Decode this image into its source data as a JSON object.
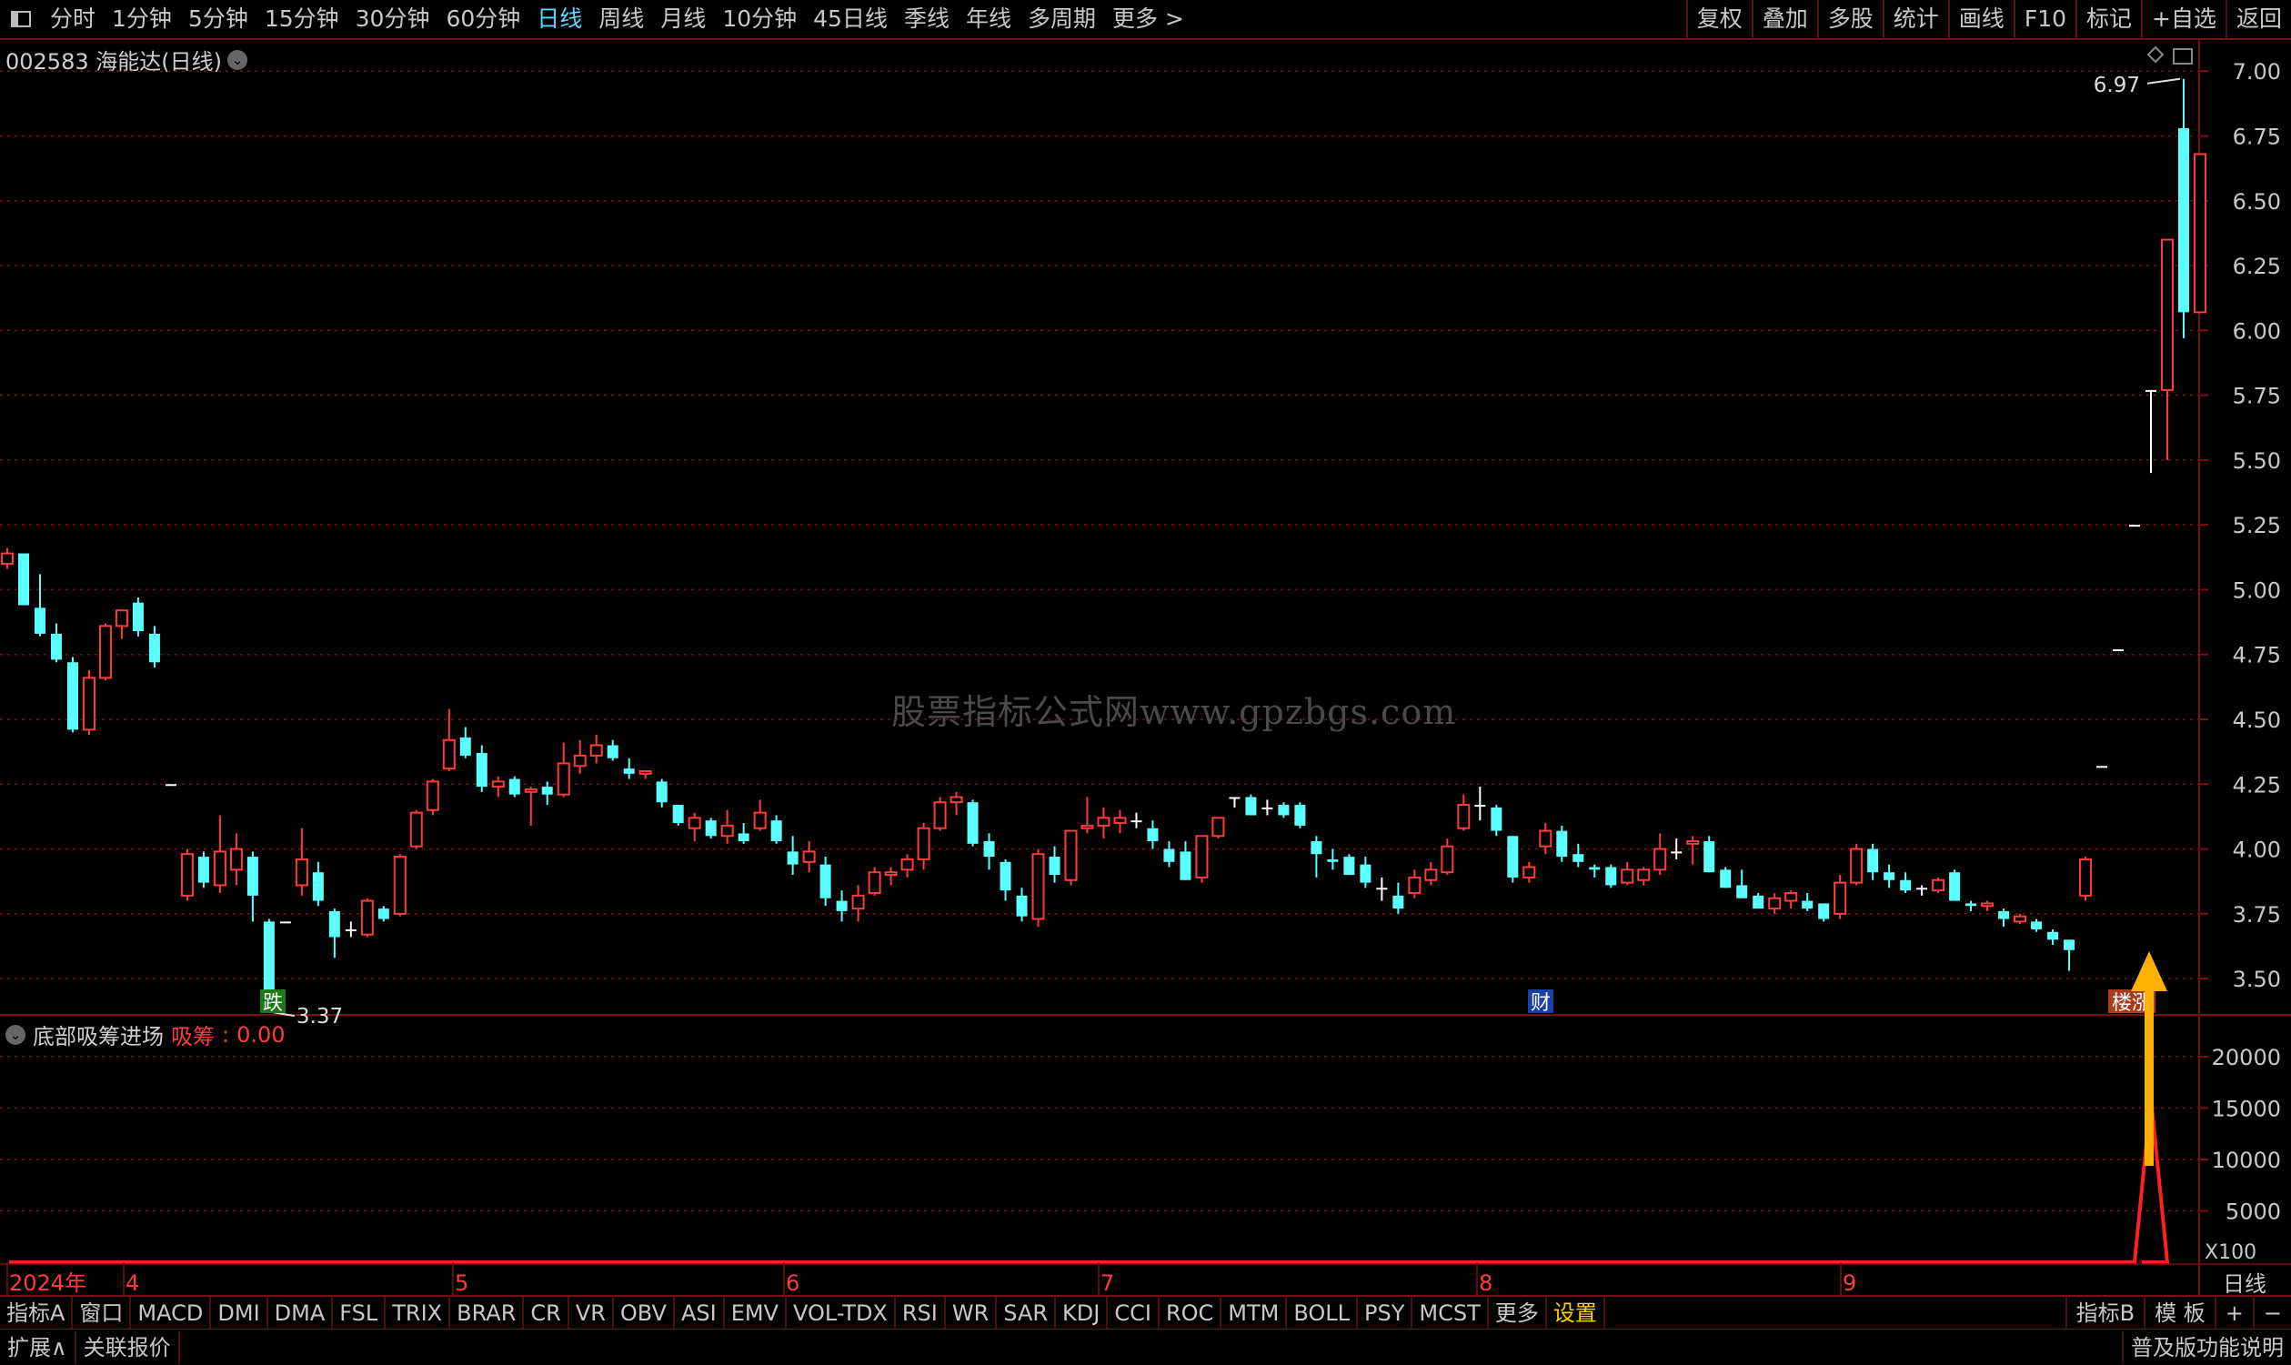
{
  "toolbar": {
    "periods": [
      "分时",
      "1分钟",
      "5分钟",
      "15分钟",
      "30分钟",
      "60分钟",
      "日线",
      "周线",
      "月线",
      "10分钟",
      "45日线",
      "季线",
      "年线",
      "多周期",
      "更多 >"
    ],
    "active_period": "日线",
    "right_buttons": [
      "复权",
      "叠加",
      "多股",
      "统计",
      "画线",
      "F10",
      "标记",
      "+自选",
      "返回"
    ]
  },
  "stock_title": "002583 海能达(日线)",
  "indicator": {
    "name": "底部吸筹进场",
    "label": "吸筹",
    "value": "0.00"
  },
  "watermark": "股票指标公式网www.gpzbgs.com",
  "bottom_tabs": [
    "指标A",
    "窗口",
    "MACD",
    "DMI",
    "DMA",
    "FSL",
    "TRIX",
    "BRAR",
    "CR",
    "VR",
    "OBV",
    "ASI",
    "EMV",
    "VOL-TDX",
    "RSI",
    "WR",
    "SAR",
    "KDJ",
    "CCI",
    "ROC",
    "MTM",
    "BOLL",
    "PSY",
    "MCST",
    "更多",
    "设置"
  ],
  "bottom_right": [
    "指标B",
    "模 板",
    "+",
    "−"
  ],
  "status": {
    "expand": "扩展∧",
    "related": "关联报价",
    "right": "普及版功能说明",
    "period_label": "日线"
  },
  "colors": {
    "up": "#ff3b3b",
    "down": "#5affff",
    "grid": "#7a1010",
    "signal": "#ffb000"
  },
  "chart_data": {
    "type": "candlestick",
    "price_axis": {
      "ylim": [
        3.36,
        7.12
      ],
      "ticks": [
        "7.00",
        "6.75",
        "6.50",
        "6.25",
        "6.00",
        "5.75",
        "5.50",
        "5.25",
        "5.00",
        "4.75",
        "4.50",
        "4.25",
        "4.00",
        "3.75",
        "3.50"
      ]
    },
    "month_labels": [
      "2024年",
      "4",
      "5",
      "6",
      "7",
      "8",
      "9"
    ],
    "high_label": "6.97",
    "low_label": "3.37",
    "markers": [
      "跌",
      "财",
      "楼涨"
    ],
    "candles": [
      [
        5.1,
        5.16,
        5.08,
        5.14
      ],
      [
        5.14,
        5.1,
        5.05,
        4.94
      ],
      [
        4.93,
        5.06,
        4.82,
        4.83
      ],
      [
        4.83,
        4.87,
        4.72,
        4.73
      ],
      [
        4.72,
        4.74,
        4.45,
        4.46
      ],
      [
        4.46,
        4.69,
        4.44,
        4.66
      ],
      [
        4.66,
        4.87,
        4.65,
        4.86
      ],
      [
        4.86,
        4.92,
        4.81,
        4.92
      ],
      [
        4.95,
        4.97,
        4.82,
        4.84
      ],
      [
        4.83,
        4.86,
        4.7,
        4.72
      ],
      [
        4.25,
        4.25,
        4.25,
        4.25
      ],
      [
        3.82,
        4.0,
        3.8,
        3.98
      ],
      [
        3.97,
        3.99,
        3.85,
        3.87
      ],
      [
        3.86,
        4.13,
        3.83,
        3.99
      ],
      [
        3.92,
        4.06,
        3.86,
        4.0
      ],
      [
        3.97,
        3.99,
        3.72,
        3.82
      ],
      [
        3.72,
        3.73,
        3.37,
        3.4
      ],
      [
        3.72,
        3.72,
        3.72,
        3.72
      ],
      [
        3.86,
        4.08,
        3.82,
        3.96
      ],
      [
        3.91,
        3.95,
        3.78,
        3.8
      ],
      [
        3.76,
        3.77,
        3.58,
        3.66
      ],
      [
        3.69,
        3.72,
        3.66,
        3.69
      ],
      [
        3.67,
        3.81,
        3.66,
        3.8
      ],
      [
        3.77,
        3.78,
        3.72,
        3.73
      ],
      [
        3.75,
        3.98,
        3.74,
        3.97
      ],
      [
        4.01,
        4.15,
        4.0,
        4.14
      ],
      [
        4.15,
        4.27,
        4.13,
        4.26
      ],
      [
        4.31,
        4.54,
        4.3,
        4.42
      ],
      [
        4.43,
        4.47,
        4.35,
        4.36
      ],
      [
        4.37,
        4.4,
        4.22,
        4.24
      ],
      [
        4.24,
        4.28,
        4.2,
        4.26
      ],
      [
        4.27,
        4.28,
        4.2,
        4.21
      ],
      [
        4.22,
        4.24,
        4.09,
        4.23
      ],
      [
        4.24,
        4.26,
        4.17,
        4.21
      ],
      [
        4.21,
        4.41,
        4.2,
        4.33
      ],
      [
        4.32,
        4.42,
        4.29,
        4.36
      ],
      [
        4.36,
        4.44,
        4.33,
        4.4
      ],
      [
        4.4,
        4.42,
        4.34,
        4.35
      ],
      [
        4.31,
        4.35,
        4.27,
        4.29
      ],
      [
        4.29,
        4.3,
        4.27,
        4.3
      ],
      [
        4.26,
        4.27,
        4.16,
        4.18
      ],
      [
        4.17,
        4.17,
        4.09,
        4.1
      ],
      [
        4.08,
        4.14,
        4.03,
        4.12
      ],
      [
        4.11,
        4.12,
        4.04,
        4.05
      ],
      [
        4.05,
        4.15,
        4.02,
        4.09
      ],
      [
        4.06,
        4.1,
        4.02,
        4.03
      ],
      [
        4.08,
        4.19,
        4.07,
        4.14
      ],
      [
        4.11,
        4.13,
        4.02,
        4.03
      ],
      [
        3.99,
        4.05,
        3.9,
        3.94
      ],
      [
        3.95,
        4.03,
        3.91,
        3.99
      ],
      [
        3.94,
        3.97,
        3.78,
        3.81
      ],
      [
        3.8,
        3.84,
        3.72,
        3.76
      ],
      [
        3.77,
        3.86,
        3.72,
        3.82
      ],
      [
        3.83,
        3.93,
        3.82,
        3.91
      ],
      [
        3.9,
        3.93,
        3.86,
        3.91
      ],
      [
        3.92,
        3.98,
        3.89,
        3.96
      ],
      [
        3.96,
        4.1,
        3.92,
        4.08
      ],
      [
        4.08,
        4.2,
        4.07,
        4.18
      ],
      [
        4.18,
        4.22,
        4.13,
        4.2
      ],
      [
        4.18,
        4.19,
        4.01,
        4.02
      ],
      [
        4.03,
        4.06,
        3.92,
        3.97
      ],
      [
        3.95,
        3.96,
        3.8,
        3.84
      ],
      [
        3.82,
        3.85,
        3.72,
        3.74
      ],
      [
        3.73,
        4.0,
        3.7,
        3.98
      ],
      [
        3.97,
        4.01,
        3.87,
        3.9
      ],
      [
        3.88,
        4.07,
        3.86,
        4.07
      ],
      [
        4.08,
        4.2,
        4.06,
        4.09
      ],
      [
        4.09,
        4.16,
        4.04,
        4.12
      ],
      [
        4.1,
        4.15,
        4.06,
        4.12
      ],
      [
        4.11,
        4.14,
        4.08,
        4.11
      ],
      [
        4.08,
        4.11,
        4.0,
        4.03
      ],
      [
        4.0,
        4.03,
        3.93,
        3.95
      ],
      [
        3.99,
        4.03,
        3.88,
        3.88
      ],
      [
        3.89,
        4.05,
        3.87,
        4.05
      ],
      [
        4.05,
        4.12,
        4.04,
        4.12
      ],
      [
        4.2,
        4.2,
        4.16,
        4.2
      ],
      [
        4.2,
        4.21,
        4.13,
        4.13
      ],
      [
        4.16,
        4.19,
        4.13,
        4.16
      ],
      [
        4.17,
        4.18,
        4.12,
        4.13
      ],
      [
        4.17,
        4.18,
        4.08,
        4.09
      ],
      [
        4.03,
        4.05,
        3.89,
        3.98
      ],
      [
        3.96,
        4.0,
        3.92,
        3.95
      ],
      [
        3.97,
        3.98,
        3.9,
        3.9
      ],
      [
        3.94,
        3.97,
        3.85,
        3.87
      ],
      [
        3.85,
        3.89,
        3.8,
        3.85
      ],
      [
        3.82,
        3.87,
        3.75,
        3.77
      ],
      [
        3.83,
        3.92,
        3.81,
        3.89
      ],
      [
        3.88,
        3.95,
        3.86,
        3.92
      ],
      [
        3.91,
        4.04,
        3.9,
        4.01
      ],
      [
        4.08,
        4.21,
        4.07,
        4.17
      ],
      [
        4.17,
        4.24,
        4.11,
        4.17
      ],
      [
        4.16,
        4.17,
        4.05,
        4.07
      ],
      [
        4.05,
        4.05,
        3.87,
        3.89
      ],
      [
        3.89,
        3.95,
        3.87,
        3.93
      ],
      [
        4.01,
        4.1,
        3.98,
        4.07
      ],
      [
        4.07,
        4.09,
        3.95,
        3.97
      ],
      [
        3.98,
        4.02,
        3.93,
        3.95
      ],
      [
        3.93,
        3.94,
        3.89,
        3.92
      ],
      [
        3.93,
        3.94,
        3.85,
        3.86
      ],
      [
        3.87,
        3.95,
        3.86,
        3.92
      ],
      [
        3.88,
        3.93,
        3.86,
        3.92
      ],
      [
        3.92,
        4.06,
        3.9,
        4.0
      ],
      [
        3.99,
        4.04,
        3.96,
        3.99
      ],
      [
        4.02,
        4.05,
        3.94,
        4.03
      ],
      [
        4.03,
        4.05,
        3.91,
        3.91
      ],
      [
        3.92,
        3.93,
        3.85,
        3.85
      ],
      [
        3.86,
        3.92,
        3.81,
        3.81
      ],
      [
        3.82,
        3.83,
        3.77,
        3.77
      ],
      [
        3.77,
        3.83,
        3.75,
        3.81
      ],
      [
        3.8,
        3.84,
        3.77,
        3.83
      ],
      [
        3.8,
        3.83,
        3.76,
        3.77
      ],
      [
        3.79,
        3.79,
        3.72,
        3.73
      ],
      [
        3.75,
        3.9,
        3.73,
        3.87
      ],
      [
        3.87,
        4.02,
        3.86,
        4.0
      ],
      [
        4.0,
        4.02,
        3.88,
        3.91
      ],
      [
        3.91,
        3.94,
        3.85,
        3.88
      ],
      [
        3.88,
        3.91,
        3.83,
        3.84
      ],
      [
        3.85,
        3.86,
        3.82,
        3.85
      ],
      [
        3.84,
        3.89,
        3.83,
        3.88
      ],
      [
        3.91,
        3.92,
        3.8,
        3.8
      ],
      [
        3.79,
        3.8,
        3.76,
        3.78
      ],
      [
        3.78,
        3.8,
        3.76,
        3.79
      ],
      [
        3.76,
        3.77,
        3.7,
        3.73
      ],
      [
        3.72,
        3.75,
        3.71,
        3.74
      ],
      [
        3.72,
        3.73,
        3.68,
        3.69
      ],
      [
        3.68,
        3.69,
        3.63,
        3.65
      ],
      [
        3.65,
        3.65,
        3.53,
        3.61
      ],
      [
        3.82,
        3.97,
        3.8,
        3.96
      ],
      [
        4.32,
        4.32,
        4.32,
        4.32
      ],
      [
        4.77,
        4.77,
        4.77,
        4.77
      ],
      [
        5.25,
        5.25,
        5.25,
        5.25
      ],
      [
        5.77,
        5.77,
        5.45,
        5.77
      ],
      [
        5.77,
        6.35,
        5.5,
        6.35
      ],
      [
        6.78,
        6.97,
        5.97,
        6.07
      ],
      [
        6.07,
        6.68,
        6.07,
        6.68
      ]
    ],
    "volume_axis": {
      "ylim": [
        0,
        23000
      ],
      "ticks": [
        "20000",
        "15000",
        "10000",
        "5000"
      ],
      "unit": "X100"
    },
    "signal_spike": {
      "value": 16000,
      "bar_index": 131
    }
  }
}
